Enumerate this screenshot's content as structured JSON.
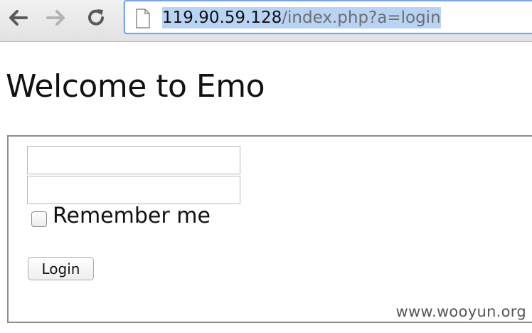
{
  "browser": {
    "url_host": "119.90.59.128",
    "url_path": "/index.php?a=login",
    "back_icon": "back-arrow-icon",
    "forward_icon": "forward-arrow-icon",
    "reload_icon": "reload-icon",
    "page_icon": "document-icon",
    "url_selected": true,
    "selection_color": "#b9d3f4"
  },
  "page": {
    "heading": "Welcome to Emo"
  },
  "login_form": {
    "username_value": "",
    "password_value": "",
    "remember_label": "Remember me",
    "remember_checked": false,
    "login_button_label": "Login"
  },
  "watermark": {
    "text": "www.wooyun.org"
  }
}
